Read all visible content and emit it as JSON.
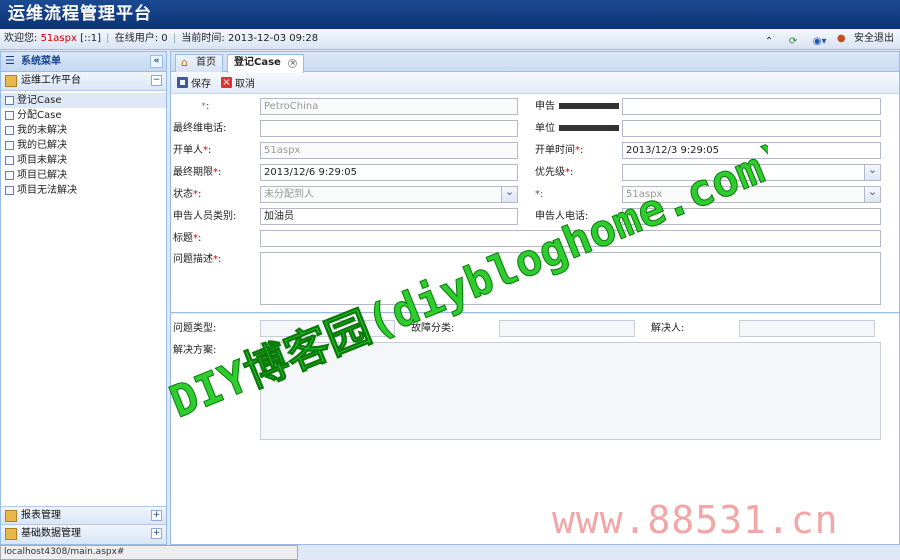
{
  "app": {
    "title": "运维流程管理平台"
  },
  "topbar": {
    "welcome_label": "欢迎您:",
    "user": "51aspx",
    "user_suffix": "[::1]",
    "online_label": "在线用户:",
    "online_count": "0",
    "time_label": "当前时间:",
    "time_value": "2013-12-03 09:28",
    "logout": "安全退出"
  },
  "sidebar": {
    "title": "系统菜单",
    "groups": [
      {
        "label": "运维工作平台",
        "items": [
          "登记Case",
          "分配Case",
          "我的未解决",
          "我的已解决",
          "项目未解决",
          "项目已解决",
          "项目无法解决"
        ]
      }
    ],
    "bottom_groups": [
      "报表管理",
      "基础数据管理"
    ]
  },
  "tabs": [
    {
      "label": "首页"
    },
    {
      "label": "登记Case"
    }
  ],
  "toolbar": {
    "save": "保存",
    "cancel": "取消"
  },
  "form": {
    "company_value": "PetroChina",
    "applicant_label": "申告",
    "phone_label": "最终维电话:",
    "unit_label": "单位",
    "opener_label": "开单人",
    "opener_value": "51aspx",
    "open_time_label": "开单时间",
    "open_time_value": "2013/12/3 9:29:05",
    "deadline_label": "最终期限",
    "deadline_value": "2013/12/6 9:29:05",
    "priority_label": "优先级",
    "status_label": "状态",
    "status_value": "未分配到人",
    "assignee_value": "51aspx",
    "reporter_type_label": "申告人员类别:",
    "reporter_type_value": "加油员",
    "reporter_phone_label": "申告人电话:",
    "subject_label": "标题",
    "desc_label": "问题描述",
    "problem_type_label": "问题类型:",
    "fault_label": "故障分类:",
    "resolver_label": "解决人:",
    "solution_label": "解决方案:"
  },
  "statusbar": {
    "url": "localhost4308/main.aspx#"
  },
  "watermarks": {
    "main": "DIY博客园(diybloghome.com)",
    "corner": "www.88531.cn"
  }
}
